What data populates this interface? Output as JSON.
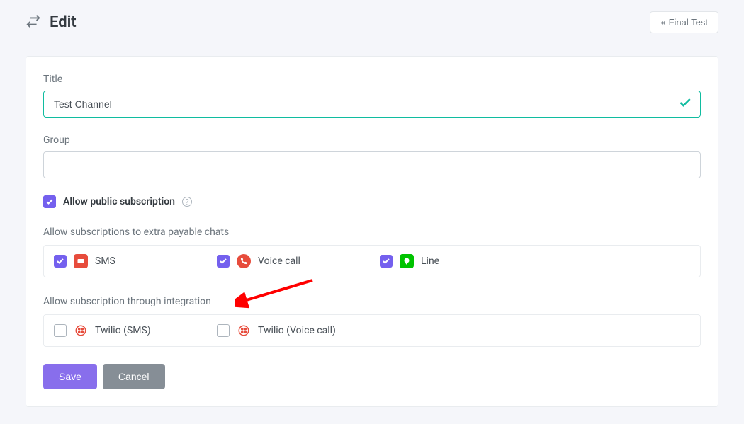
{
  "header": {
    "title": "Edit",
    "breadcrumb_label": "Final Test"
  },
  "form": {
    "title_label": "Title",
    "title_value": "Test Channel",
    "group_label": "Group",
    "group_value": "",
    "allow_public_label": "Allow public subscription",
    "allow_public_checked": true,
    "extra_chats_label": "Allow subscriptions to extra payable chats",
    "integration_label": "Allow subscription through integration"
  },
  "chats": [
    {
      "label": "SMS",
      "checked": true,
      "icon": "sms"
    },
    {
      "label": "Voice call",
      "checked": true,
      "icon": "voice"
    },
    {
      "label": "Line",
      "checked": true,
      "icon": "line"
    }
  ],
  "integrations": [
    {
      "label": "Twilio (SMS)",
      "checked": false,
      "icon": "twilio"
    },
    {
      "label": "Twilio (Voice call)",
      "checked": false,
      "icon": "twilio"
    }
  ],
  "buttons": {
    "save": "Save",
    "cancel": "Cancel"
  }
}
